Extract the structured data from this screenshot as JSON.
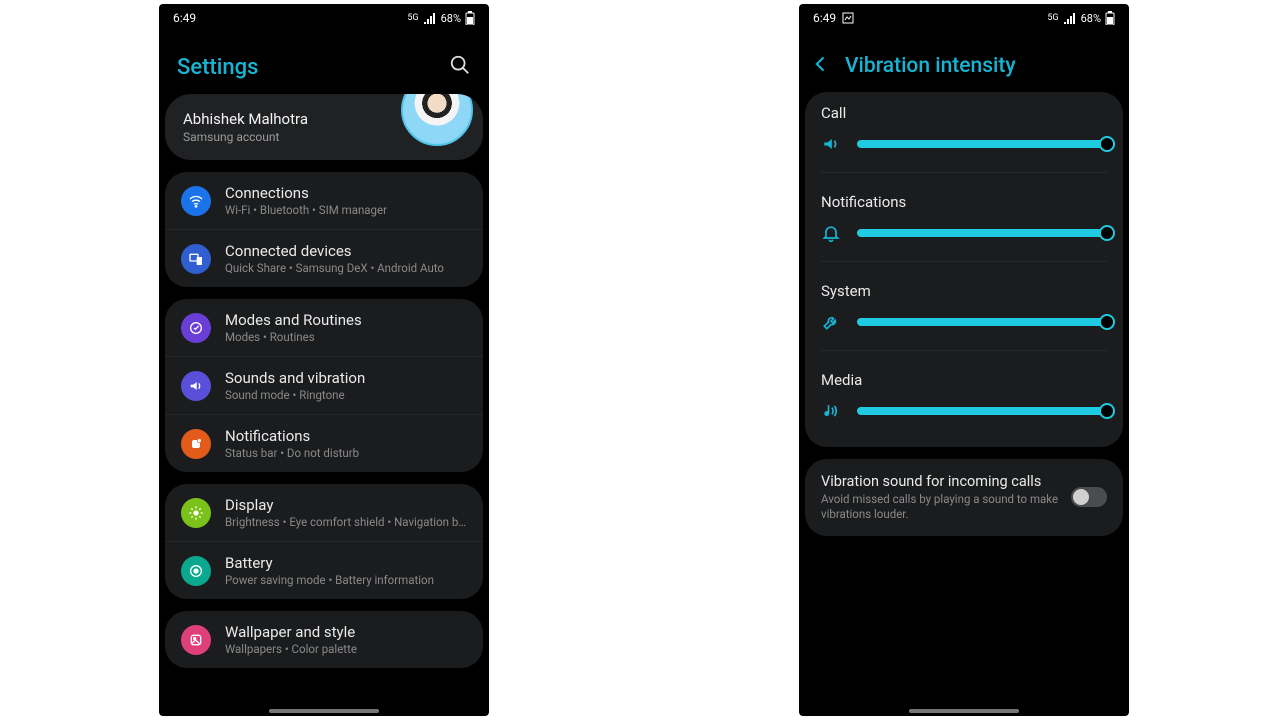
{
  "status": {
    "time": "6:49",
    "battery": "68%"
  },
  "left": {
    "title": "Settings",
    "account": {
      "name": "Abhishek Malhotra",
      "sub": "Samsung account"
    },
    "groups": [
      [
        {
          "icon": "wifi-icon",
          "color": "ic-blue",
          "title": "Connections",
          "sub": "Wi-Fi • Bluetooth • SIM manager"
        },
        {
          "icon": "devices-icon",
          "color": "ic-blue2",
          "title": "Connected devices",
          "sub": "Quick Share • Samsung DeX • Android Auto"
        }
      ],
      [
        {
          "icon": "routines-icon",
          "color": "ic-purple",
          "title": "Modes and Routines",
          "sub": "Modes • Routines"
        },
        {
          "icon": "sound-icon",
          "color": "ic-purple2",
          "title": "Sounds and vibration",
          "sub": "Sound mode • Ringtone"
        },
        {
          "icon": "notifications-icon",
          "color": "ic-orange",
          "title": "Notifications",
          "sub": "Status bar • Do not disturb"
        }
      ],
      [
        {
          "icon": "display-icon",
          "color": "ic-green",
          "title": "Display",
          "sub": "Brightness • Eye comfort shield • Navigation bar"
        },
        {
          "icon": "battery-icon",
          "color": "ic-teal",
          "title": "Battery",
          "sub": "Power saving mode • Battery information"
        }
      ],
      [
        {
          "icon": "wallpaper-icon",
          "color": "ic-pink",
          "title": "Wallpaper and style",
          "sub": "Wallpapers • Color palette"
        }
      ]
    ]
  },
  "right": {
    "title": "Vibration intensity",
    "sliders": [
      {
        "label": "Call",
        "icon": "volume-icon",
        "value": 100
      },
      {
        "label": "Notifications",
        "icon": "bell-icon",
        "value": 100
      },
      {
        "label": "System",
        "icon": "wrench-icon",
        "value": 100
      },
      {
        "label": "Media",
        "icon": "music-icon",
        "value": 100
      }
    ],
    "toggle": {
      "title": "Vibration sound for incoming calls",
      "sub": "Avoid missed calls by playing a sound to make vibrations louder.",
      "on": false
    }
  }
}
